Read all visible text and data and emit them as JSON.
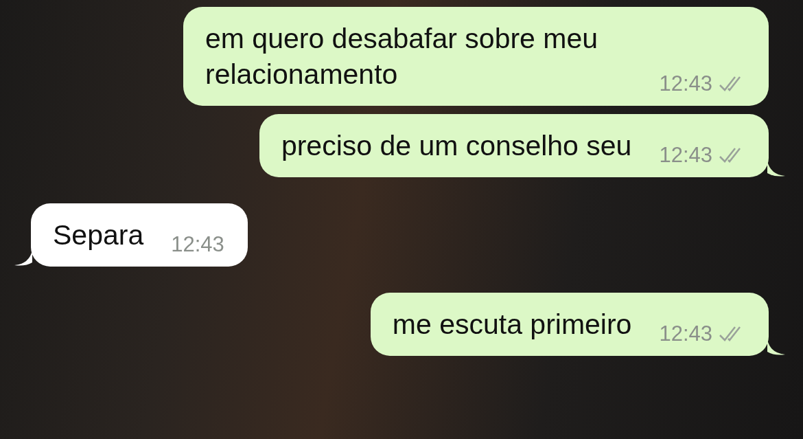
{
  "messages": [
    {
      "kind": "outgoing",
      "text": "em quero desabafar sobre meu relacionamento",
      "time": "12:43",
      "read": false
    },
    {
      "kind": "outgoing",
      "text": "preciso de um conselho seu",
      "time": "12:43",
      "read": false
    },
    {
      "kind": "incoming",
      "text": "Separa",
      "time": "12:43"
    },
    {
      "kind": "outgoing",
      "text": "me escuta primeiro",
      "time": "12:43",
      "read": false
    }
  ]
}
